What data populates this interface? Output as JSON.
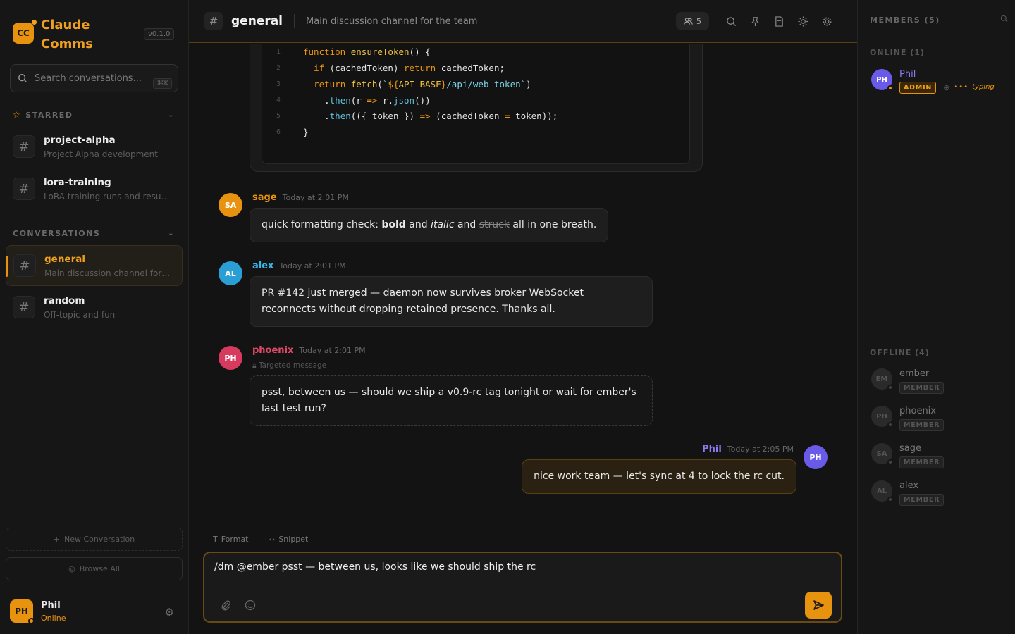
{
  "app": {
    "logo_initials": "CC",
    "name": "Claude Comms",
    "version": "v0.1.0"
  },
  "search": {
    "placeholder": "Search conversations...",
    "shortcut": "⌘K"
  },
  "sidebar": {
    "starred_label": "STARRED",
    "conversations_label": "CONVERSATIONS",
    "starred": [
      {
        "name": "project-alpha",
        "desc": "Project Alpha development"
      },
      {
        "name": "lora-training",
        "desc": "LoRA training runs and results"
      }
    ],
    "conversations": [
      {
        "name": "general",
        "desc": "Main discussion channel for the team",
        "active": true
      },
      {
        "name": "random",
        "desc": "Off-topic and fun",
        "active": false
      }
    ],
    "new_conversation": "New Conversation",
    "browse_all": "Browse All"
  },
  "current_user": {
    "initials": "PH",
    "name": "Phil",
    "status": "Online"
  },
  "header": {
    "title": "general",
    "desc": "Main discussion channel for the team",
    "member_count": "5"
  },
  "code": {
    "lines": [
      {
        "n": "1"
      },
      {
        "n": "2"
      },
      {
        "n": "3"
      },
      {
        "n": "4"
      },
      {
        "n": "5"
      },
      {
        "n": "6"
      }
    ]
  },
  "messages": [
    {
      "initials": "SA",
      "author": "sage",
      "time": "Today at 2:01 PM"
    },
    {
      "initials": "AL",
      "author": "alex",
      "time": "Today at 2:01 PM",
      "text": "PR #142 just merged — daemon now survives broker WebSocket reconnects without dropping retained presence. Thanks all."
    },
    {
      "initials": "PH",
      "author": "phoenix",
      "time": "Today at 2:01 PM",
      "targeted": "Targeted message",
      "text": "psst, between us — should we ship a v0.9-rc tag tonight or wait for ember's last test run?"
    },
    {
      "initials": "PH",
      "author": "Phil",
      "time": "Today at 2:05 PM",
      "text": "nice work team — let's sync at 4 to lock the rc cut."
    }
  ],
  "formatting_msg": {
    "pre": "quick formatting check: ",
    "bold": "bold",
    "and1": " and ",
    "italic": "italic",
    "and2": " and ",
    "strike": "struck",
    "post": " all in one breath."
  },
  "composer": {
    "format": "Format",
    "snippet": "Snippet",
    "value": "/dm @ember psst — between us, looks like we should ship the rc"
  },
  "members_panel": {
    "title": "MEMBERS (5)",
    "online_label": "ONLINE (1)",
    "offline_label": "OFFLINE (4)",
    "online": [
      {
        "initials": "PH",
        "name": "Phil",
        "role": "ADMIN",
        "typing": "typing"
      }
    ],
    "offline": [
      {
        "initials": "EM",
        "name": "ember",
        "role": "MEMBER"
      },
      {
        "initials": "PH",
        "name": "phoenix",
        "role": "MEMBER"
      },
      {
        "initials": "SA",
        "name": "sage",
        "role": "MEMBER"
      },
      {
        "initials": "AL",
        "name": "alex",
        "role": "MEMBER"
      }
    ]
  },
  "colors": {
    "accent": "#e8930f",
    "sage": "#e8930f",
    "alex": "#38b6e8",
    "phoenix": "#e24a6a",
    "phil": "#6a5ae8"
  }
}
